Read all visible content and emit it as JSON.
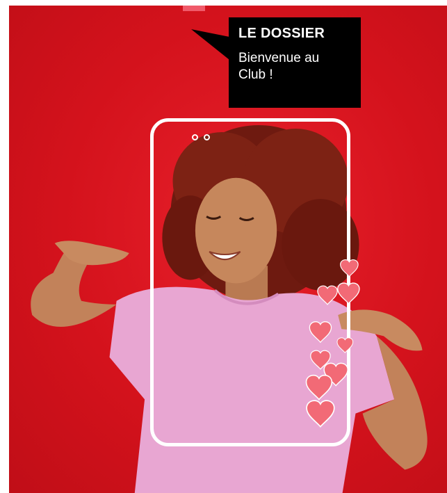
{
  "bubble": {
    "title": "LE DOSSIER",
    "text": "Bienvenue au Club !"
  },
  "colors": {
    "background_red": "#d4121c",
    "bubble_black": "#000000",
    "frame_white": "#ffffff",
    "shirt_pink": "#e8a6d2",
    "heart_pink": "#f26a76"
  },
  "icons": {
    "frame": "smartphone-frame-icon",
    "hearts": "heart-icon"
  }
}
